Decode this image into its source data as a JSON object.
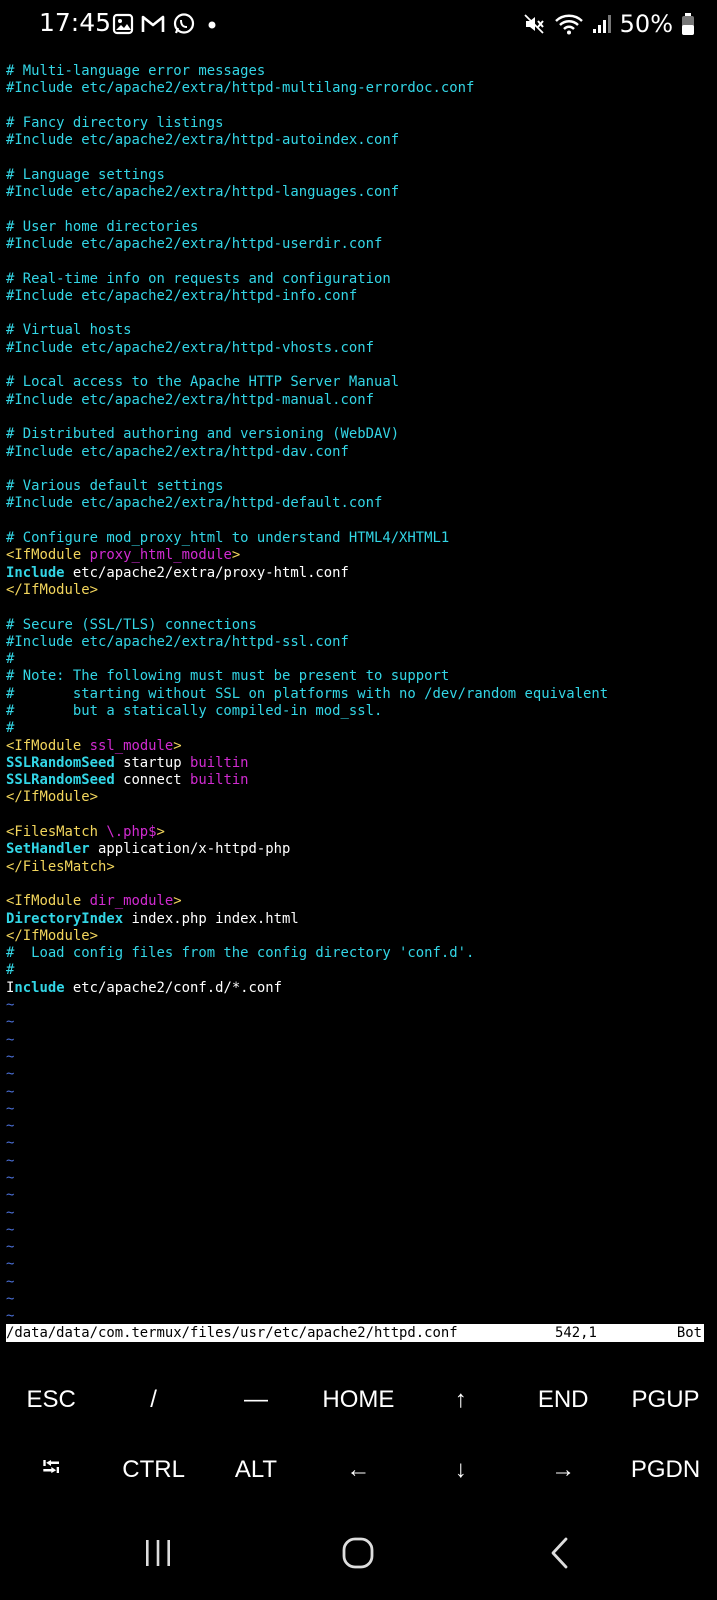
{
  "status_bar": {
    "time": "17:45",
    "left_icons": [
      "gallery-icon",
      "gmail-icon",
      "whatsapp-icon",
      "dot-icon"
    ],
    "right_icons": [
      "mute-icon",
      "wifi-icon",
      "signal-icon"
    ],
    "battery": "50%"
  },
  "editor": {
    "lines": [
      [
        {
          "t": "# Multi-language error messages",
          "c": "comment"
        }
      ],
      [
        {
          "t": "#Include etc/apache2/extra/httpd-multilang-errordoc.conf",
          "c": "comment"
        }
      ],
      [],
      [
        {
          "t": "# Fancy directory listings",
          "c": "comment"
        }
      ],
      [
        {
          "t": "#Include etc/apache2/extra/httpd-autoindex.conf",
          "c": "comment"
        }
      ],
      [],
      [
        {
          "t": "# Language settings",
          "c": "comment"
        }
      ],
      [
        {
          "t": "#Include etc/apache2/extra/httpd-languages.conf",
          "c": "comment"
        }
      ],
      [],
      [
        {
          "t": "# User home directories",
          "c": "comment"
        }
      ],
      [
        {
          "t": "#Include etc/apache2/extra/httpd-userdir.conf",
          "c": "comment"
        }
      ],
      [],
      [
        {
          "t": "# Real-time info on requests and configuration",
          "c": "comment"
        }
      ],
      [
        {
          "t": "#Include etc/apache2/extra/httpd-info.conf",
          "c": "comment"
        }
      ],
      [],
      [
        {
          "t": "# Virtual hosts",
          "c": "comment"
        }
      ],
      [
        {
          "t": "#Include etc/apache2/extra/httpd-vhosts.conf",
          "c": "comment"
        }
      ],
      [],
      [
        {
          "t": "# Local access to the Apache HTTP Server Manual",
          "c": "comment"
        }
      ],
      [
        {
          "t": "#Include etc/apache2/extra/httpd-manual.conf",
          "c": "comment"
        }
      ],
      [],
      [
        {
          "t": "# Distributed authoring and versioning (WebDAV)",
          "c": "comment"
        }
      ],
      [
        {
          "t": "#Include etc/apache2/extra/httpd-dav.conf",
          "c": "comment"
        }
      ],
      [],
      [
        {
          "t": "# Various default settings",
          "c": "comment"
        }
      ],
      [
        {
          "t": "#Include etc/apache2/extra/httpd-default.conf",
          "c": "comment"
        }
      ],
      [],
      [
        {
          "t": "# Configure mod_proxy_html to understand HTML4/XHTML1",
          "c": "comment"
        }
      ],
      [
        {
          "t": "<IfModule ",
          "c": "tag"
        },
        {
          "t": "proxy_html_module",
          "c": "arg"
        },
        {
          "t": ">",
          "c": "tag"
        }
      ],
      [
        {
          "t": "Include",
          "c": "key"
        },
        {
          "t": " etc/apache2/extra/proxy-html.conf",
          "c": "text"
        }
      ],
      [
        {
          "t": "</IfModule>",
          "c": "tag"
        }
      ],
      [],
      [
        {
          "t": "# Secure (SSL/TLS) connections",
          "c": "comment"
        }
      ],
      [
        {
          "t": "#Include etc/apache2/extra/httpd-ssl.conf",
          "c": "comment"
        }
      ],
      [
        {
          "t": "#",
          "c": "comment"
        }
      ],
      [
        {
          "t": "# Note: The following must must be present to support",
          "c": "comment"
        }
      ],
      [
        {
          "t": "#       starting without SSL on platforms with no /dev/random equivalent",
          "c": "comment"
        }
      ],
      [
        {
          "t": "#       but a statically compiled-in mod_ssl.",
          "c": "comment"
        }
      ],
      [
        {
          "t": "#",
          "c": "comment"
        }
      ],
      [
        {
          "t": "<IfModule ",
          "c": "tag"
        },
        {
          "t": "ssl_module",
          "c": "arg"
        },
        {
          "t": ">",
          "c": "tag"
        }
      ],
      [
        {
          "t": "SSLRandomSeed",
          "c": "key"
        },
        {
          "t": " startup ",
          "c": "text"
        },
        {
          "t": "builtin",
          "c": "arg"
        }
      ],
      [
        {
          "t": "SSLRandomSeed",
          "c": "key"
        },
        {
          "t": " connect ",
          "c": "text"
        },
        {
          "t": "builtin",
          "c": "arg"
        }
      ],
      [
        {
          "t": "</IfModule>",
          "c": "tag"
        }
      ],
      [],
      [
        {
          "t": "<FilesMatch ",
          "c": "tag"
        },
        {
          "t": "\\.php$",
          "c": "arg"
        },
        {
          "t": ">",
          "c": "tag"
        }
      ],
      [
        {
          "t": "SetHandler",
          "c": "key"
        },
        {
          "t": " application/x-httpd-php",
          "c": "text"
        }
      ],
      [
        {
          "t": "</FilesMatch>",
          "c": "tag"
        }
      ],
      [],
      [
        {
          "t": "<IfModule ",
          "c": "tag"
        },
        {
          "t": "dir_module",
          "c": "arg"
        },
        {
          "t": ">",
          "c": "tag"
        }
      ],
      [
        {
          "t": "DirectoryIndex",
          "c": "key"
        },
        {
          "t": " index.php index.html",
          "c": "text"
        }
      ],
      [
        {
          "t": "</IfModule>",
          "c": "tag"
        }
      ],
      [
        {
          "t": "#  Load config files from the config directory 'conf.d'.",
          "c": "comment"
        }
      ],
      [
        {
          "t": "#",
          "c": "comment"
        }
      ],
      [
        {
          "t": "I",
          "c": "cursor"
        },
        {
          "t": "nclude",
          "c": "key"
        },
        {
          "t": " etc/apache2/conf.d/*.conf",
          "c": "text"
        }
      ]
    ],
    "tilde_count": 20,
    "status_path": "/data/data/com.termux/files/usr/etc/apache2/httpd.conf",
    "status_position": "542,1",
    "status_scroll": "Bot"
  },
  "extra_keys": {
    "row1": [
      "ESC",
      "/",
      "—",
      "HOME",
      "↑",
      "END",
      "PGUP"
    ],
    "row2": [
      "⭾",
      "CTRL",
      "ALT",
      "←",
      "↓",
      "→",
      "PGDN"
    ]
  },
  "nav_bar": {
    "buttons": [
      "recent-apps-icon",
      "home-icon",
      "back-icon"
    ]
  },
  "colors": {
    "comment": "#33d6e6",
    "tag": "#f2d55c",
    "arg": "#d12bd1",
    "text": "#ffffff",
    "tilde": "#4a6fd6",
    "background": "#000000"
  }
}
